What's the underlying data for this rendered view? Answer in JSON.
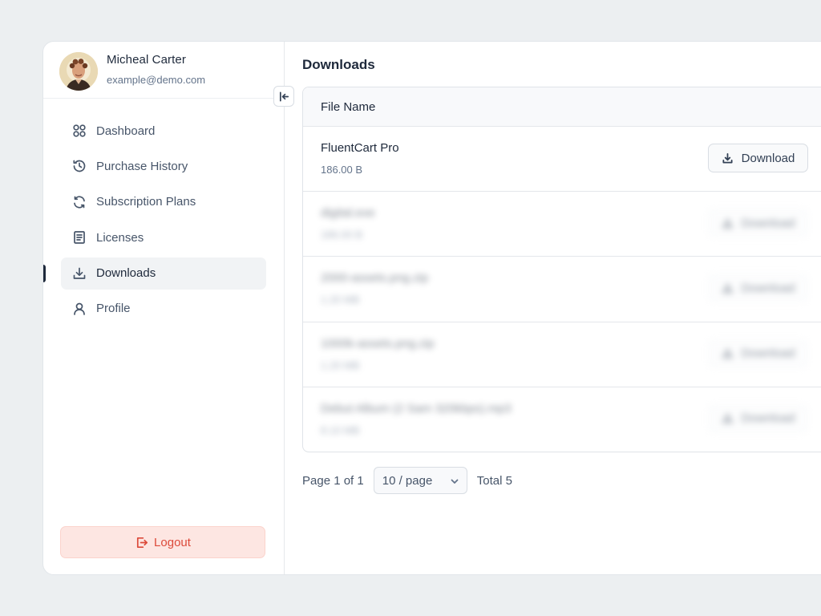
{
  "user": {
    "name": "Micheal Carter",
    "email": "example@demo.com"
  },
  "sidebar": {
    "items": [
      {
        "label": "Dashboard",
        "icon": "dashboard-icon",
        "active": false
      },
      {
        "label": "Purchase History",
        "icon": "history-icon",
        "active": false
      },
      {
        "label": "Subscription Plans",
        "icon": "refresh-icon",
        "active": false
      },
      {
        "label": "Licenses",
        "icon": "document-icon",
        "active": false
      },
      {
        "label": "Downloads",
        "icon": "download-icon",
        "active": true
      },
      {
        "label": "Profile",
        "icon": "user-icon",
        "active": false
      }
    ],
    "logout_label": "Logout"
  },
  "main": {
    "title": "Downloads",
    "table": {
      "header": "File Name",
      "button_label": "Download",
      "rows": [
        {
          "name": "FluentCart Pro",
          "size": "186.00 B"
        },
        {
          "name": "digital.exe",
          "size": "186.00 B"
        },
        {
          "name": "2000-assets.png.zip",
          "size": "1.20 MB"
        },
        {
          "name": "1000k-assets.png.zip",
          "size": "1.20 MB"
        },
        {
          "name": "Debut Album (2 Sam 320kbps).mp3",
          "size": "8.10 MB"
        }
      ]
    },
    "pagination": {
      "page_info": "Page 1 of 1",
      "page_size": "10 / page",
      "total": "Total 5"
    }
  },
  "colors": {
    "accent": "#1e293b",
    "logout_bg": "#fde6e2",
    "logout_text": "#dc4a3a",
    "background": "#eceff1"
  }
}
